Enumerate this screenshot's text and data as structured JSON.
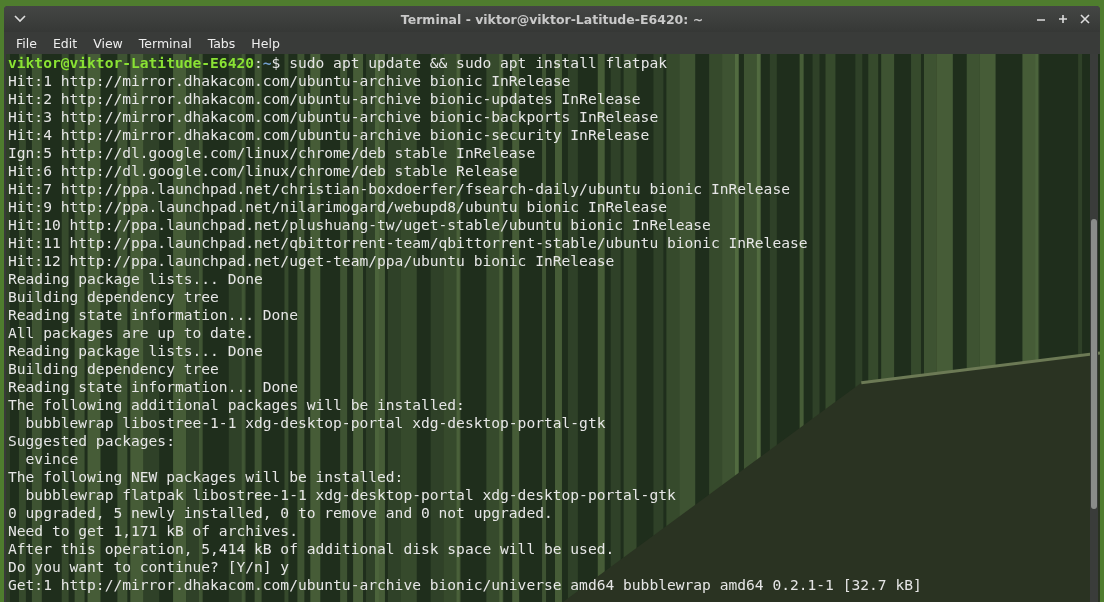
{
  "window": {
    "title": "Terminal - viktor@viktor-Latitude-E6420: ~"
  },
  "menu": [
    "File",
    "Edit",
    "View",
    "Terminal",
    "Tabs",
    "Help"
  ],
  "prompt": {
    "user_host": "viktor@viktor-Latitude-E6420",
    "separator": ":",
    "path": "~",
    "command": "$ sudo apt update && sudo apt install flatpak"
  },
  "output": [
    "Hit:1 http://mirror.dhakacom.com/ubuntu-archive bionic InRelease",
    "Hit:2 http://mirror.dhakacom.com/ubuntu-archive bionic-updates InRelease",
    "Hit:3 http://mirror.dhakacom.com/ubuntu-archive bionic-backports InRelease",
    "Hit:4 http://mirror.dhakacom.com/ubuntu-archive bionic-security InRelease",
    "Ign:5 http://dl.google.com/linux/chrome/deb stable InRelease",
    "Hit:6 http://dl.google.com/linux/chrome/deb stable Release",
    "Hit:7 http://ppa.launchpad.net/christian-boxdoerfer/fsearch-daily/ubuntu bionic InRelease",
    "Hit:9 http://ppa.launchpad.net/nilarimogard/webupd8/ubuntu bionic InRelease",
    "Hit:10 http://ppa.launchpad.net/plushuang-tw/uget-stable/ubuntu bionic InRelease",
    "Hit:11 http://ppa.launchpad.net/qbittorrent-team/qbittorrent-stable/ubuntu bionic InRelease",
    "Hit:12 http://ppa.launchpad.net/uget-team/ppa/ubuntu bionic InRelease",
    "Reading package lists... Done",
    "Building dependency tree",
    "Reading state information... Done",
    "All packages are up to date.",
    "Reading package lists... Done",
    "Building dependency tree",
    "Reading state information... Done",
    "The following additional packages will be installed:",
    "  bubblewrap libostree-1-1 xdg-desktop-portal xdg-desktop-portal-gtk",
    "Suggested packages:",
    "  evince",
    "The following NEW packages will be installed:",
    "  bubblewrap flatpak libostree-1-1 xdg-desktop-portal xdg-desktop-portal-gtk",
    "0 upgraded, 5 newly installed, 0 to remove and 0 not upgraded.",
    "Need to get 1,171 kB of archives.",
    "After this operation, 5,414 kB of additional disk space will be used.",
    "Do you want to continue? [Y/n] y",
    "Get:1 http://mirror.dhakacom.com/ubuntu-archive bionic/universe amd64 bubblewrap amd64 0.2.1-1 [32.7 kB]"
  ]
}
